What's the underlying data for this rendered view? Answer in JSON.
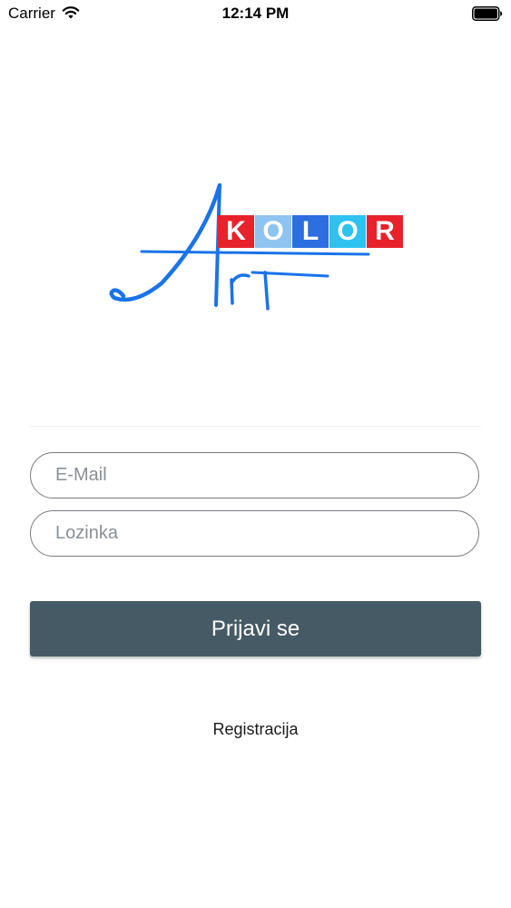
{
  "status_bar": {
    "carrier": "Carrier",
    "time": "12:14 PM"
  },
  "logo": {
    "letters": [
      "K",
      "O",
      "L",
      "O",
      "R"
    ],
    "script_word": "Art",
    "tile_colors": [
      "#e8222b",
      "#8fc3f0",
      "#2d6ee0",
      "#2ec2ef",
      "#e8222b"
    ],
    "stroke_color": "#1a73e8"
  },
  "login_form": {
    "email_placeholder": "E-Mail",
    "password_placeholder": "Lozinka",
    "submit_label": "Prijavi se",
    "register_label": "Registracija"
  },
  "colors": {
    "button": "#455a64",
    "field_border": "#767b80"
  }
}
